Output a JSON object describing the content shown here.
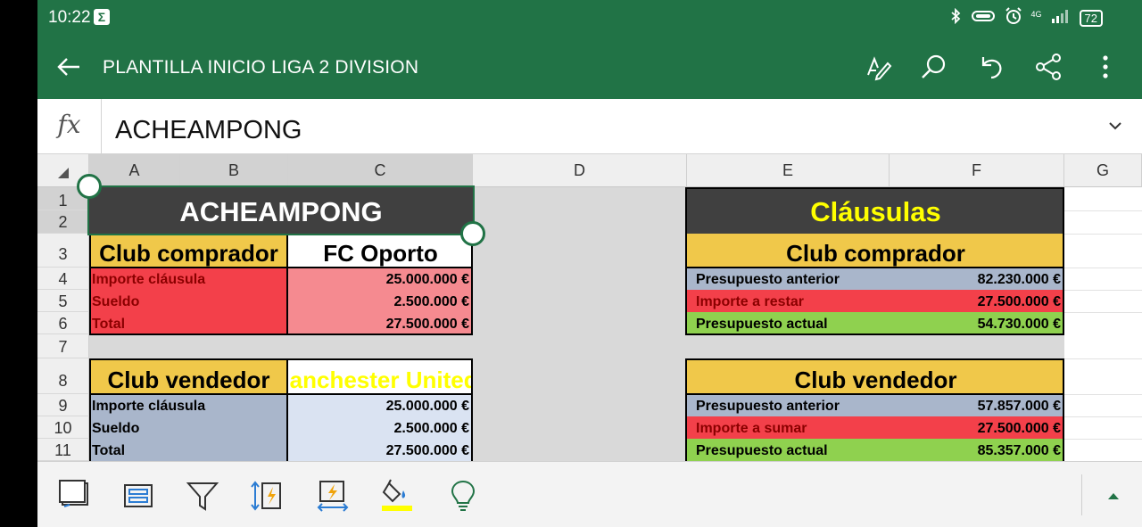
{
  "status_bar": {
    "time": "10:22",
    "battery": "72",
    "network": "4G"
  },
  "app_bar": {
    "title": "PLANTILLA INICIO LIGA 2 DIVISION"
  },
  "formula_bar": {
    "fx_label": "fx",
    "value": "ACHEAMPONG"
  },
  "columns": [
    "A",
    "B",
    "C",
    "D",
    "E",
    "F",
    "G"
  ],
  "rows": [
    "1",
    "2",
    "3",
    "4",
    "5",
    "6",
    "7",
    "8",
    "9",
    "10",
    "11"
  ],
  "left": {
    "title": "ACHEAMPONG",
    "buyer": {
      "label": "Club comprador",
      "club": "FC Oporto",
      "lines": [
        {
          "label": "Importe cláusula",
          "value": "25.000.000 €"
        },
        {
          "label": "Sueldo",
          "value": "2.500.000 €"
        },
        {
          "label": "Total",
          "value": "27.500.000 €"
        }
      ]
    },
    "seller": {
      "label": "Club vendedor",
      "club": "Manchester United",
      "club_color": "#ffff00",
      "lines": [
        {
          "label": "Importe cláusula",
          "value": "25.000.000 €"
        },
        {
          "label": "Sueldo",
          "value": "2.500.000 €"
        },
        {
          "label": "Total",
          "value": "27.500.000 €"
        }
      ]
    }
  },
  "right": {
    "title": "Cláusulas",
    "title_color": "#ffff00",
    "buyer": {
      "label": "Club comprador",
      "lines": [
        {
          "label": "Presupuesto anterior",
          "value": "82.230.000 €"
        },
        {
          "label": "Importe a restar",
          "value": "27.500.000 €"
        },
        {
          "label": "Presupuesto actual",
          "value": "54.730.000 €"
        }
      ]
    },
    "seller": {
      "label": "Club vendedor",
      "lines": [
        {
          "label": "Presupuesto anterior",
          "value": "57.857.000 €"
        },
        {
          "label": "Importe a sumar",
          "value": "27.500.000 €"
        },
        {
          "label": "Presupuesto actual",
          "value": "85.357.000 €"
        }
      ]
    }
  },
  "colors": {
    "accent": "#217346",
    "fill_color_swatch": "#ffff00"
  }
}
